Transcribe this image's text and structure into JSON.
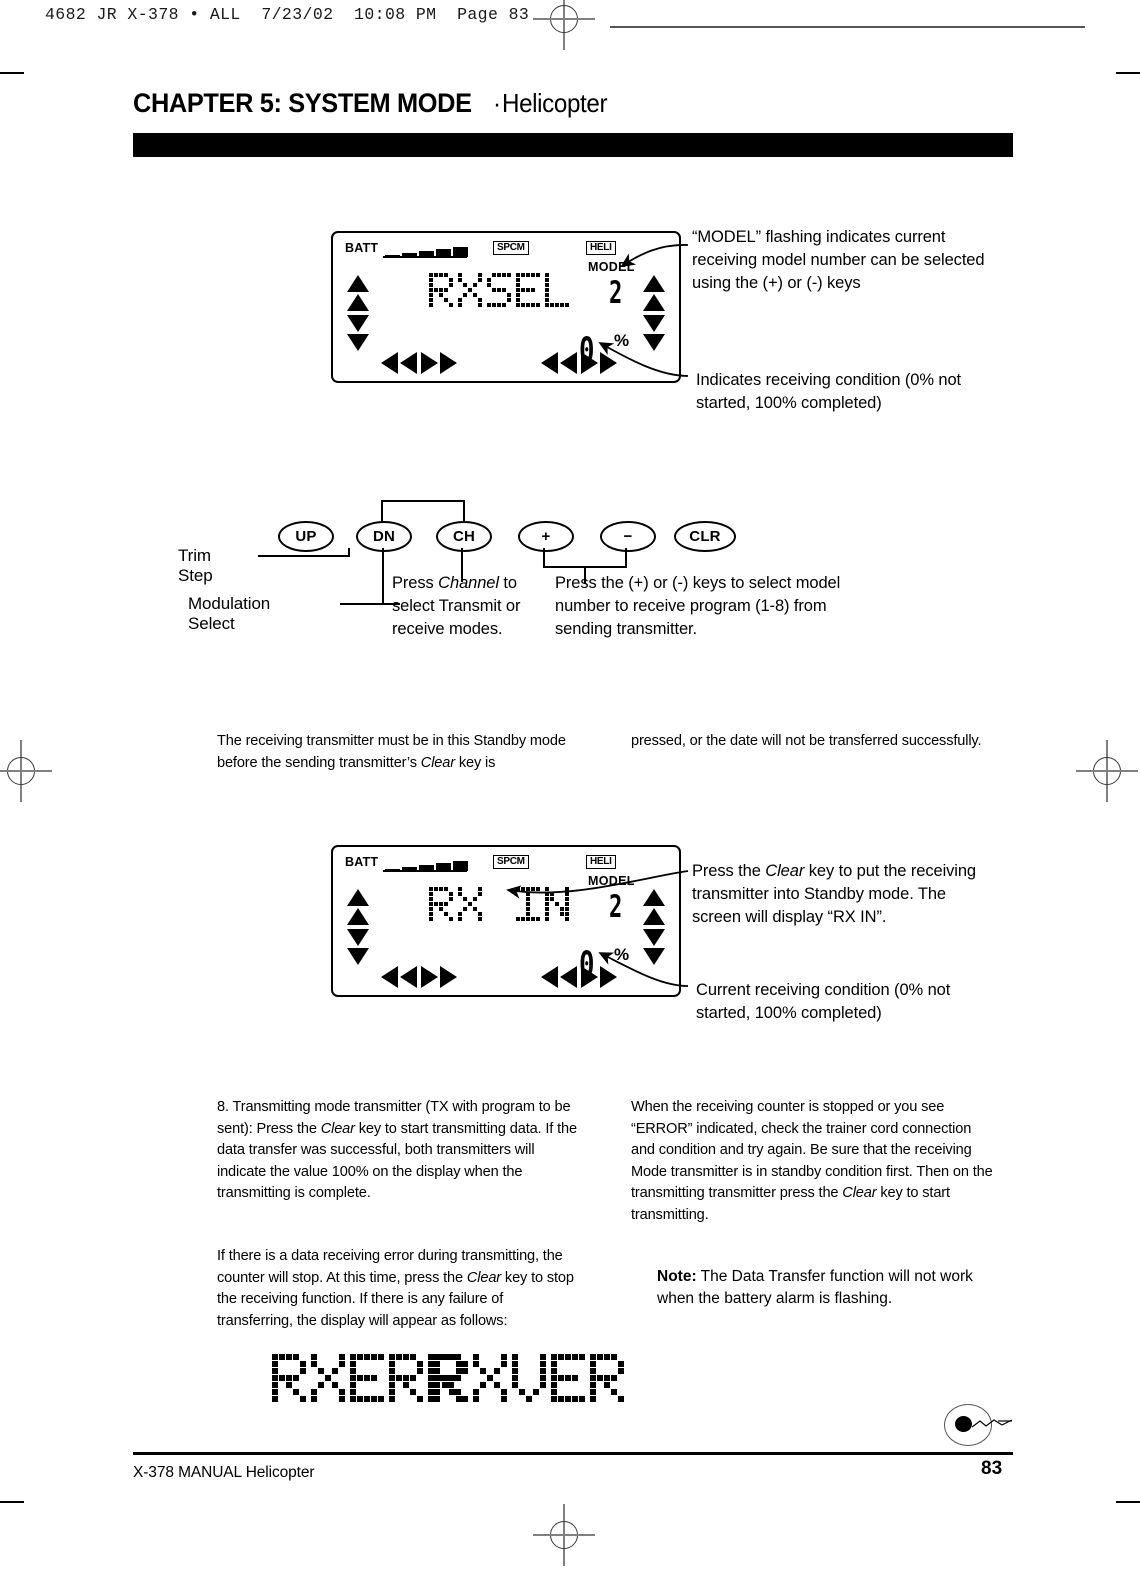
{
  "file_header": "4682 JR X-378 • ALL  7/23/02  10:08 PM  Page 83",
  "chapter": {
    "bold_part": "CHAPTER 5: SYSTEM MODE",
    "separator": " · ",
    "light_part": "Helicopter"
  },
  "lcd_top": {
    "batt_label": "BATT",
    "spcm_badge": "SPCM",
    "heli_badge": "HELI",
    "model_label": "MODEL",
    "model_number": "2",
    "percent_value": "0",
    "percent_symbol": "%",
    "matrix_text": "RXSEL"
  },
  "lcd_bottom": {
    "batt_label": "BATT",
    "spcm_badge": "SPCM",
    "heli_badge": "HELI",
    "model_label": "MODEL",
    "model_number": "2",
    "percent_value": "0",
    "percent_symbol": "%",
    "matrix_text": "RX IN"
  },
  "annotations": {
    "model_flashing": "“MODEL” flashing indicates current receiving model number can be selected using the (+) or (-) keys",
    "receiving_condition_top": "Indicates receiving condition (0% not started, 100% completed)",
    "press_clear": "Press the Clear key to put the receiving transmitter into Standby mode. The screen will display “RX IN”.",
    "press_clear_pre": "Press the ",
    "press_clear_italic": "Clear",
    "press_clear_post": " key to put the receiving transmitter into Standby mode. The screen will display “RX IN”.",
    "receiving_condition_bottom": "Current receiving condition (0% not started, 100% completed)"
  },
  "keys": {
    "items": [
      {
        "label": "UP",
        "name": "up-key"
      },
      {
        "label": "DN",
        "name": "dn-key"
      },
      {
        "label": "CH",
        "name": "ch-key"
      },
      {
        "label": "+",
        "name": "plus-key"
      },
      {
        "label": "−",
        "name": "minus-key"
      },
      {
        "label": "CLR",
        "name": "clr-key"
      }
    ],
    "trim_step_label": "Trim Step",
    "modulation_label": "Modulation Select",
    "channel_caption_pre": "Press ",
    "channel_caption_italic": "Channel",
    "channel_caption_post": " to select Transmit or receive modes.",
    "plusminus_caption": "Press the (+) or (-) keys to select model number to receive program (1-8) from sending transmitter."
  },
  "body": {
    "standby_left_a": "The receiving transmitter must be in this Standby mode before the sending transmitter’s ",
    "standby_left_italic": "Clear",
    "standby_left_b": " key is",
    "standby_right": "pressed, or the date will not be transferred successfully.",
    "para8_a": "8. Transmitting mode transmitter (TX with program to be sent): Press the ",
    "para8_italic": "Clear",
    "para8_b": " key to start transmitting data. If the data transfer was successful, both transmitters will indicate the value 100% on the display when the transmitting is complete.",
    "para9_a": "If there is a data receiving error during transmitting, the counter will stop. At this time, press the ",
    "para9_italic": "Clear",
    "para9_b": " key to stop the receiving function. If there is any failure of transferring, the display will appear as follows:",
    "right_a": "When the receiving counter is stopped or you see “ERROR” indicated, check the  trainer cord connection and condition and try again. Be sure that the receiving Mode transmitter is in standby condition first. Then on the transmitting transmitter press the ",
    "right_italic": "Clear",
    "right_b": " key to start transmitting.",
    "note_label": "Note:",
    "note_text": " The Data Transfer function will not work when the battery alarm is flashing."
  },
  "error_displays": {
    "first": "RXERR",
    "second": "RXVER"
  },
  "footer": {
    "left": "X-378 MANUAL  Helicopter",
    "page": "83"
  },
  "colors": {
    "ink": "#000000",
    "paper": "#ffffff",
    "regmark": "#808080"
  }
}
